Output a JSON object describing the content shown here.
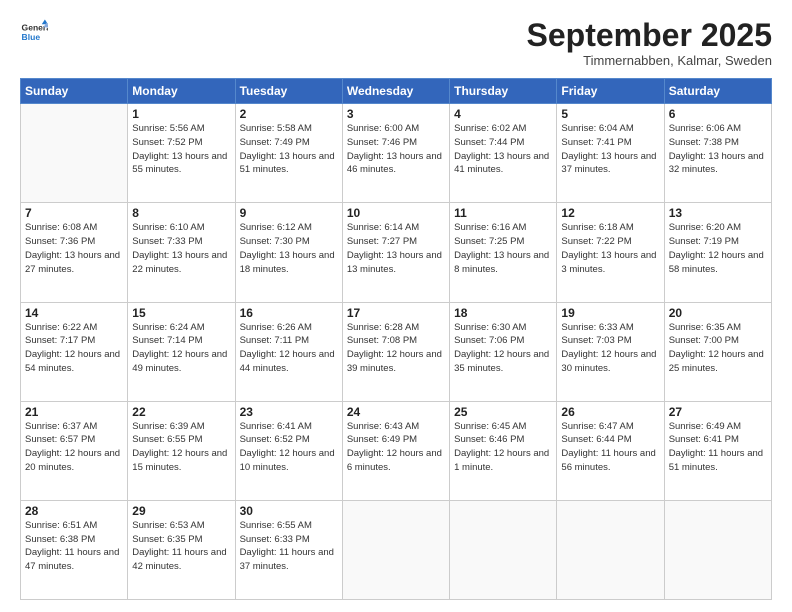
{
  "header": {
    "logo": {
      "general": "General",
      "blue": "Blue"
    },
    "title": "September 2025",
    "subtitle": "Timmernabben, Kalmar, Sweden"
  },
  "weekdays": [
    "Sunday",
    "Monday",
    "Tuesday",
    "Wednesday",
    "Thursday",
    "Friday",
    "Saturday"
  ],
  "weeks": [
    [
      {
        "day": null
      },
      {
        "day": 1,
        "sunrise": "5:56 AM",
        "sunset": "7:52 PM",
        "daylight": "13 hours and 55 minutes."
      },
      {
        "day": 2,
        "sunrise": "5:58 AM",
        "sunset": "7:49 PM",
        "daylight": "13 hours and 51 minutes."
      },
      {
        "day": 3,
        "sunrise": "6:00 AM",
        "sunset": "7:46 PM",
        "daylight": "13 hours and 46 minutes."
      },
      {
        "day": 4,
        "sunrise": "6:02 AM",
        "sunset": "7:44 PM",
        "daylight": "13 hours and 41 minutes."
      },
      {
        "day": 5,
        "sunrise": "6:04 AM",
        "sunset": "7:41 PM",
        "daylight": "13 hours and 37 minutes."
      },
      {
        "day": 6,
        "sunrise": "6:06 AM",
        "sunset": "7:38 PM",
        "daylight": "13 hours and 32 minutes."
      }
    ],
    [
      {
        "day": 7,
        "sunrise": "6:08 AM",
        "sunset": "7:36 PM",
        "daylight": "13 hours and 27 minutes."
      },
      {
        "day": 8,
        "sunrise": "6:10 AM",
        "sunset": "7:33 PM",
        "daylight": "13 hours and 22 minutes."
      },
      {
        "day": 9,
        "sunrise": "6:12 AM",
        "sunset": "7:30 PM",
        "daylight": "13 hours and 18 minutes."
      },
      {
        "day": 10,
        "sunrise": "6:14 AM",
        "sunset": "7:27 PM",
        "daylight": "13 hours and 13 minutes."
      },
      {
        "day": 11,
        "sunrise": "6:16 AM",
        "sunset": "7:25 PM",
        "daylight": "13 hours and 8 minutes."
      },
      {
        "day": 12,
        "sunrise": "6:18 AM",
        "sunset": "7:22 PM",
        "daylight": "13 hours and 3 minutes."
      },
      {
        "day": 13,
        "sunrise": "6:20 AM",
        "sunset": "7:19 PM",
        "daylight": "12 hours and 58 minutes."
      }
    ],
    [
      {
        "day": 14,
        "sunrise": "6:22 AM",
        "sunset": "7:17 PM",
        "daylight": "12 hours and 54 minutes."
      },
      {
        "day": 15,
        "sunrise": "6:24 AM",
        "sunset": "7:14 PM",
        "daylight": "12 hours and 49 minutes."
      },
      {
        "day": 16,
        "sunrise": "6:26 AM",
        "sunset": "7:11 PM",
        "daylight": "12 hours and 44 minutes."
      },
      {
        "day": 17,
        "sunrise": "6:28 AM",
        "sunset": "7:08 PM",
        "daylight": "12 hours and 39 minutes."
      },
      {
        "day": 18,
        "sunrise": "6:30 AM",
        "sunset": "7:06 PM",
        "daylight": "12 hours and 35 minutes."
      },
      {
        "day": 19,
        "sunrise": "6:33 AM",
        "sunset": "7:03 PM",
        "daylight": "12 hours and 30 minutes."
      },
      {
        "day": 20,
        "sunrise": "6:35 AM",
        "sunset": "7:00 PM",
        "daylight": "12 hours and 25 minutes."
      }
    ],
    [
      {
        "day": 21,
        "sunrise": "6:37 AM",
        "sunset": "6:57 PM",
        "daylight": "12 hours and 20 minutes."
      },
      {
        "day": 22,
        "sunrise": "6:39 AM",
        "sunset": "6:55 PM",
        "daylight": "12 hours and 15 minutes."
      },
      {
        "day": 23,
        "sunrise": "6:41 AM",
        "sunset": "6:52 PM",
        "daylight": "12 hours and 10 minutes."
      },
      {
        "day": 24,
        "sunrise": "6:43 AM",
        "sunset": "6:49 PM",
        "daylight": "12 hours and 6 minutes."
      },
      {
        "day": 25,
        "sunrise": "6:45 AM",
        "sunset": "6:46 PM",
        "daylight": "12 hours and 1 minute."
      },
      {
        "day": 26,
        "sunrise": "6:47 AM",
        "sunset": "6:44 PM",
        "daylight": "11 hours and 56 minutes."
      },
      {
        "day": 27,
        "sunrise": "6:49 AM",
        "sunset": "6:41 PM",
        "daylight": "11 hours and 51 minutes."
      }
    ],
    [
      {
        "day": 28,
        "sunrise": "6:51 AM",
        "sunset": "6:38 PM",
        "daylight": "11 hours and 47 minutes."
      },
      {
        "day": 29,
        "sunrise": "6:53 AM",
        "sunset": "6:35 PM",
        "daylight": "11 hours and 42 minutes."
      },
      {
        "day": 30,
        "sunrise": "6:55 AM",
        "sunset": "6:33 PM",
        "daylight": "11 hours and 37 minutes."
      },
      {
        "day": null
      },
      {
        "day": null
      },
      {
        "day": null
      },
      {
        "day": null
      }
    ]
  ]
}
